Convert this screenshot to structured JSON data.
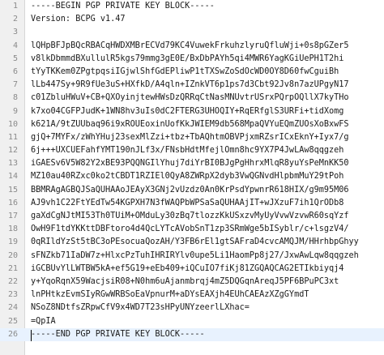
{
  "editor": {
    "current_line": 26,
    "lines": [
      "-----BEGIN PGP PRIVATE KEY BLOCK-----",
      "Version: BCPG v1.47",
      "",
      "lQHpBFJpBQcRBACqHWDXMBrECVd79KC4VuwekFrkuhzlyruQfluWji+0s8pGZer5",
      "v8lkDbmmdBXullulR5kgs79mmg3gE0E/BxDbPAYh5qi4MWR6YagKGiUePH1T2hi",
      "tYyTKKem0ZPgtpqsiIGjwlShfGdEPliwP1tTXSwZoSdOcWD0OY8D60fwCguiBh",
      "lLb447Sy+9R9fUe3uS+HXfkD/A4qln+IZnkVT6p1ps7d3Cbt92Jv8n7azUPgyN17",
      "c01ZbluHWuV+CB+QXOyinjtewHWsDzQRRqCtNasMNUvtrUSrxPQrpOQllX7kyTHo",
      "k7xo04CGFPJudK+1WN8hv3uIs0dC2FTERG3UHOQIY+RqERfglS3URFi+tidXomg",
      "k621A/9tZUUbaq96i9xROUEoxinUofKkJWIEM9db568MpaQVYuEQmZUOsXoBxwFS",
      "gjQ+7MYFx/zWhYHuj23sexMlZzi+tbz+TbAQhtmOBVPjxmRZsrICxEknY+Iyx7/g",
      "6j+++UXCUEFahfYMT190nJLf3x/FNsbHdtMfejlOmn8hc9YX7P4JwLAw8qqgzeh",
      "iGAESv6V5W82Y2xBE93PQQNGIlYhuj7diYrBI0BJgPgHhrxMlqR8yuYsPeMnKK50",
      "MZ10au40RZxc0ko2tCBDT1RZIEl0QyA8ZWRpX2dyb3VwQGNvdHlpbmMuY29tPoh",
      "BBMRAgAGBQJSaQUHAAoJEAyX3GNj2vUzdz0An0KrPsdYpwnrR618HIX/g9m95M06",
      "AJ9vh1C22FtYEdTw54KGPXH7N3fWAQPbWPSaSaQUHAAjIT+wJXzuF7ih1QrODb8",
      "gaXdCgNJtMI53Th0TUiM+OMduLy30zBq7tlozzKkUSxzvMyUyVvwVzvwR60sqYzf",
      "OwH9F1tdYKKttDBFtoro4d4QcLYTcAVobSnT1zp3SRmWge5bISyblr/c+lsgzV4/",
      "0qRIldYzSt5tBC3oPEsocuaQozAH/Y3FB6rEl1gtSAFraD4cvcAMQJM/HHrhbpGhyy",
      "sFNZkb71IaDW7z+HlxcPzTuhIHRIRYlv0upe5Li1HaomPp8j27/JxwAwLqw8qqgzeh",
      "iGCBUvYlLWTBW5kA+ef5G19+eEb409+iQCuIO7fiKj81ZGQAQCAG2ETIkbiyqj4",
      "y+YqoRqnX59WacjsiR08+N0hm6uAjanmbrqj4mZ5DQGqnAreqJ5PF6BPuPC3xt",
      "lnPHtkzEvmSIyRGwWRBSoEaVpnurM+aDYsEAXjh4EUhCAEAzXZgGYmdT",
      "NSoZ8NDtfsZRpwCfV9x4WD7T23sHPyUNYzeerlLXhac=",
      "=QpIA",
      "-----END PGP PRIVATE KEY BLOCK-----"
    ]
  }
}
